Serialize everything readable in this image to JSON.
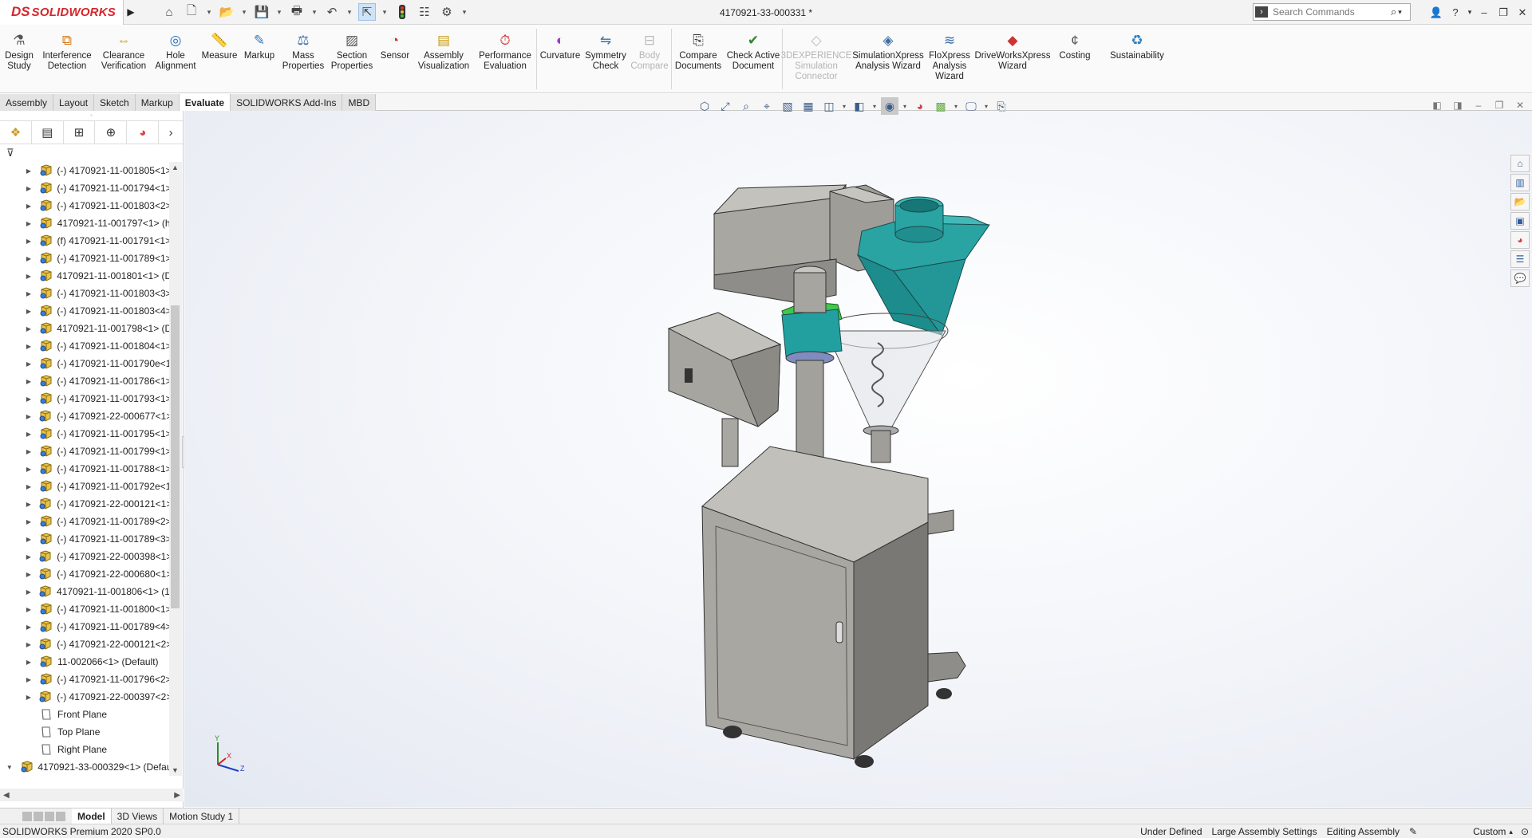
{
  "app": {
    "logo_ds": "DS",
    "logo_name": "SOLIDWORKS",
    "document_title": "4170921-33-000331 *"
  },
  "search": {
    "placeholder": "Search Commands"
  },
  "ribbon": [
    {
      "name": "design-study-button",
      "icon": "design-study-icon",
      "label": "Design\nStudy",
      "w": 48
    },
    {
      "name": "interference-detection-button",
      "icon": "interference-icon",
      "label": "Interference\nDetection",
      "w": 72
    },
    {
      "name": "clearance-verification-button",
      "icon": "clearance-icon",
      "label": "Clearance\nVerification",
      "w": 70
    },
    {
      "name": "hole-alignment-button",
      "icon": "hole-alignment-icon",
      "label": "Hole\nAlignment",
      "w": 60
    },
    {
      "name": "measure-button",
      "icon": "measure-icon",
      "label": "Measure",
      "w": 50
    },
    {
      "name": "markup-button",
      "icon": "markup-icon",
      "label": "Markup",
      "w": 50
    },
    {
      "name": "mass-properties-button",
      "icon": "mass-properties-icon",
      "label": "Mass\nProperties",
      "w": 60
    },
    {
      "name": "section-properties-button",
      "icon": "section-properties-icon",
      "label": "Section\nProperties",
      "w": 62
    },
    {
      "name": "sensor-button",
      "icon": "sensor-icon",
      "label": "Sensor",
      "w": 46
    },
    {
      "name": "assembly-visualization-button",
      "icon": "assembly-visualization-icon",
      "label": "Assembly\nVisualization",
      "w": 76
    },
    {
      "name": "performance-evaluation-button",
      "icon": "performance-icon",
      "label": "Performance\nEvaluation",
      "w": 78
    },
    {
      "sep": true
    },
    {
      "name": "curvature-button",
      "icon": "curvature-icon",
      "label": "Curvature",
      "w": 58
    },
    {
      "name": "symmetry-check-button",
      "icon": "symmetry-icon",
      "label": "Symmetry\nCheck",
      "w": 56
    },
    {
      "name": "body-compare-button",
      "icon": "body-compare-icon",
      "label": "Body\nCompare",
      "w": 54,
      "dim": true
    },
    {
      "sep": true
    },
    {
      "name": "compare-documents-button",
      "icon": "compare-docs-icon",
      "label": "Compare\nDocuments",
      "w": 66
    },
    {
      "name": "check-active-document-button",
      "icon": "check-doc-icon",
      "label": "Check Active\nDocument",
      "w": 72
    },
    {
      "sep": true
    },
    {
      "name": "3dexperience-simulation-connector-button",
      "icon": "3dx-icon",
      "label": "3DEXPERIENCE\nSimulation\nConnector",
      "w": 84,
      "dim": true
    },
    {
      "name": "simulationxpress-button",
      "icon": "simulationxpress-icon",
      "label": "SimulationXpress\nAnalysis Wizard",
      "w": 96
    },
    {
      "name": "floxpress-button",
      "icon": "floxpress-icon",
      "label": "FloXpress\nAnalysis\nWizard",
      "w": 58
    },
    {
      "name": "driveworksxpress-button",
      "icon": "driveworks-icon",
      "label": "DriveWorksXpress\nWizard",
      "w": 100
    },
    {
      "name": "costing-button",
      "icon": "costing-icon",
      "label": "Costing",
      "w": 56
    },
    {
      "name": "sustainability-button",
      "icon": "sustainability-icon",
      "label": "Sustainability",
      "w": 100
    }
  ],
  "tabs": [
    "Assembly",
    "Layout",
    "Sketch",
    "Markup",
    "Evaluate",
    "SOLIDWORKS Add-Ins",
    "MBD"
  ],
  "active_tab": "Evaluate",
  "tree": [
    {
      "label": "(-) 4170921-11-001805<1>",
      "type": "comp"
    },
    {
      "label": "(-) 4170921-11-001794<1>",
      "type": "comp"
    },
    {
      "label": "(-) 4170921-11-001803<2>",
      "type": "comp"
    },
    {
      "label": "4170921-11-001797<1> (h",
      "type": "comp"
    },
    {
      "label": "(f) 4170921-11-001791<1>",
      "type": "comp"
    },
    {
      "label": "(-) 4170921-11-001789<1>",
      "type": "comp"
    },
    {
      "label": "4170921-11-001801<1> (D",
      "type": "comp"
    },
    {
      "label": "(-) 4170921-11-001803<3>",
      "type": "comp"
    },
    {
      "label": "(-) 4170921-11-001803<4>",
      "type": "comp"
    },
    {
      "label": "4170921-11-001798<1> (D",
      "type": "comp"
    },
    {
      "label": "(-) 4170921-11-001804<1>",
      "type": "comp"
    },
    {
      "label": "(-) 4170921-11-001790e<1",
      "type": "comp"
    },
    {
      "label": "(-) 4170921-11-001786<1>",
      "type": "comp"
    },
    {
      "label": "(-) 4170921-11-001793<1>",
      "type": "comp"
    },
    {
      "label": "(-) 4170921-22-000677<1>",
      "type": "comp"
    },
    {
      "label": "(-) 4170921-11-001795<1>",
      "type": "comp"
    },
    {
      "label": "(-) 4170921-11-001799<1>",
      "type": "comp"
    },
    {
      "label": "(-) 4170921-11-001788<1>",
      "type": "comp"
    },
    {
      "label": "(-) 4170921-11-001792e<1",
      "type": "comp"
    },
    {
      "label": "(-) 4170921-22-000121<1>",
      "type": "comp"
    },
    {
      "label": "(-) 4170921-11-001789<2>",
      "type": "comp"
    },
    {
      "label": "(-) 4170921-11-001789<3>",
      "type": "comp"
    },
    {
      "label": "(-) 4170921-22-000398<1>",
      "type": "comp"
    },
    {
      "label": "(-) 4170921-22-000680<1>",
      "type": "comp"
    },
    {
      "label": "4170921-11-001806<1> (1!",
      "type": "comp"
    },
    {
      "label": "(-) 4170921-11-001800<1>",
      "type": "comp"
    },
    {
      "label": "(-) 4170921-11-001789<4>",
      "type": "comp"
    },
    {
      "label": "(-) 4170921-22-000121<2>",
      "type": "comp"
    },
    {
      "label": "11-002066<1> (Default)",
      "type": "comp"
    },
    {
      "label": "(-) 4170921-11-001796<2>",
      "type": "comp"
    },
    {
      "label": "(-) 4170921-22-000397<2>",
      "type": "comp"
    },
    {
      "label": "Front Plane",
      "type": "plane"
    },
    {
      "label": "Top Plane",
      "type": "plane"
    },
    {
      "label": "Right Plane",
      "type": "plane"
    },
    {
      "label": "4170921-33-000329<1> (Defau",
      "type": "root"
    }
  ],
  "bottom_tabs": [
    "Model",
    "3D Views",
    "Motion Study 1"
  ],
  "active_bottom_tab": "Model",
  "status": {
    "product": "SOLIDWORKS Premium 2020 SP0.0",
    "state": "Under Defined",
    "large_assembly": "Large Assembly Settings",
    "mode": "Editing Assembly",
    "units": "Custom"
  },
  "triad": {
    "x": "X",
    "y": "Y",
    "z": "Z"
  },
  "colors": {
    "model_body": "#a3a19c",
    "model_dark": "#6f6d69",
    "hopper_teal": "#1f9c9c",
    "flange_green": "#3fc94a",
    "brand_red": "#d6262b"
  }
}
